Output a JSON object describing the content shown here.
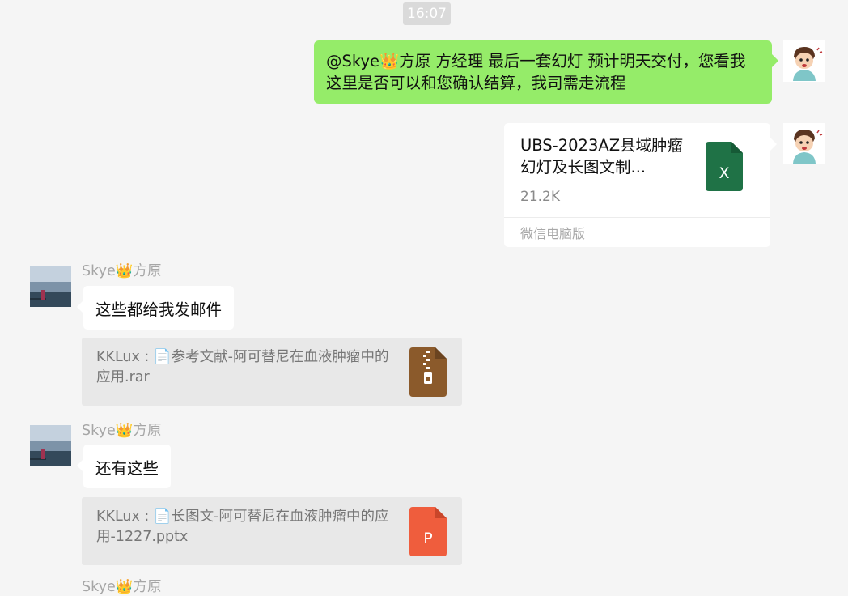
{
  "timestamp": "16:07",
  "messages": {
    "outgoing_text": "@Skye👑方原 方经理 最后一套幻灯 预计明天交付，您看我这里是否可以和您确认结算，我司需走流程",
    "outgoing_file": {
      "file_name": "UBS-2023AZ县域肿瘤幻灯及长图文制...",
      "file_size": "21.2K",
      "source": "微信电脑版",
      "icon": "excel-file-icon"
    },
    "incoming_1": {
      "sender": "Skye👑方原",
      "text": "这些都给我发邮件",
      "quote": "KKLux : 📄参考文献-阿可替尼在血液肿瘤中的应用.rar",
      "quote_icon": "rar-archive-icon"
    },
    "incoming_2": {
      "sender": "Skye👑方原",
      "text": "还有这些",
      "quote": "KKLux : 📄长图文-阿可替尼在血液肿瘤中的应用-1227.pptx",
      "quote_icon": "powerpoint-file-icon"
    },
    "incoming_3_partial": {
      "sender": "Skye👑方原"
    }
  },
  "colors": {
    "background": "#f5f5f5",
    "outgoing_bubble": "#95ec69",
    "incoming_bubble": "#ffffff",
    "quote_background": "#e8e8e8",
    "excel_green": "#1f7246",
    "archive_brown": "#8b5a2b",
    "ppt_orange": "#ef5d3d"
  }
}
